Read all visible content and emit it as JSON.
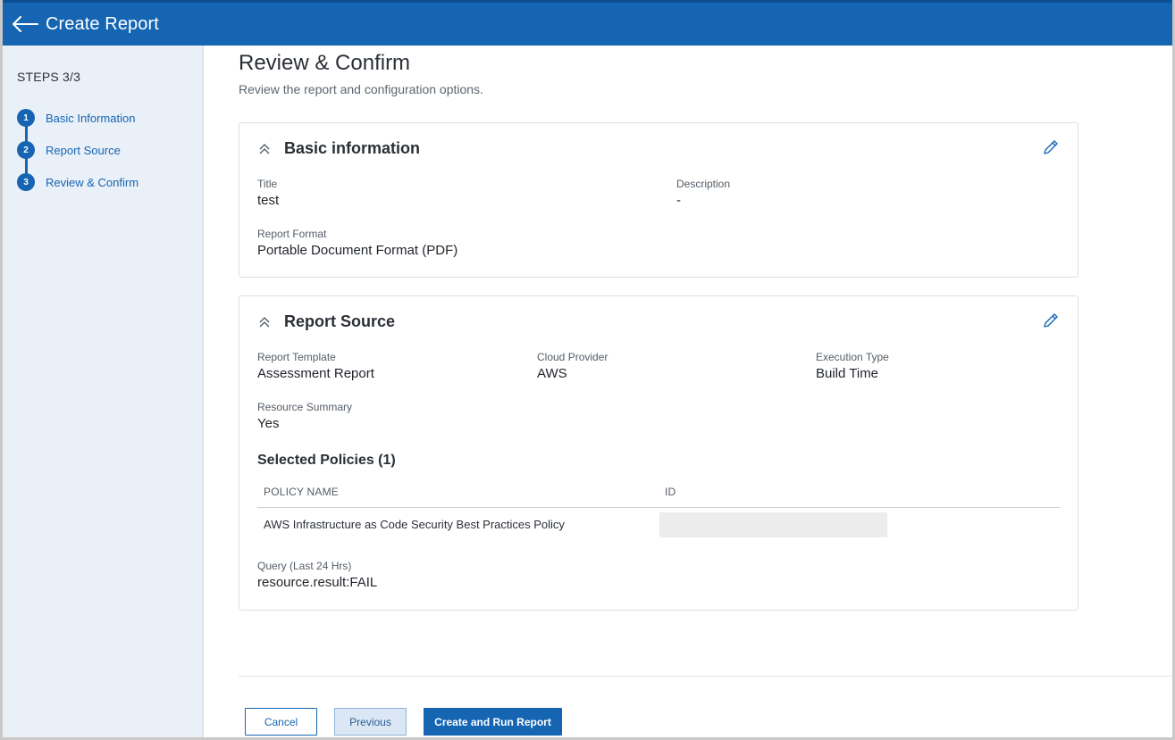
{
  "header": {
    "title": "Create Report",
    "back_icon": "arrow-left-icon"
  },
  "sidebar": {
    "steps_label": "STEPS 3/3",
    "steps": [
      {
        "number": "1",
        "label": "Basic Information"
      },
      {
        "number": "2",
        "label": "Report Source"
      },
      {
        "number": "3",
        "label": "Review & Confirm"
      }
    ]
  },
  "main": {
    "title": "Review & Confirm",
    "subtitle": "Review the report and configuration options."
  },
  "basic_info": {
    "heading": "Basic information",
    "title_label": "Title",
    "title_value": "test",
    "description_label": "Description",
    "description_value": "-",
    "format_label": "Report Format",
    "format_value": "Portable Document Format (PDF)"
  },
  "report_source": {
    "heading": "Report Source",
    "template_label": "Report Template",
    "template_value": "Assessment Report",
    "provider_label": "Cloud Provider",
    "provider_value": "AWS",
    "execution_label": "Execution Type",
    "execution_value": "Build Time",
    "summary_label": "Resource Summary",
    "summary_value": "Yes",
    "policies_heading": "Selected Policies (1)",
    "policies_columns": [
      "POLICY NAME",
      "ID"
    ],
    "policies_rows": [
      {
        "name": "AWS Infrastructure as Code Security Best Practices Policy",
        "id": ""
      }
    ],
    "query_label": "Query (Last 24 Hrs)",
    "query_value": "resource.result:FAIL"
  },
  "footer": {
    "cancel_label": "Cancel",
    "previous_label": "Previous",
    "create_label": "Create and Run Report"
  },
  "colors": {
    "primary": "#1565b3",
    "sidebar_bg": "#e9f0f8"
  }
}
